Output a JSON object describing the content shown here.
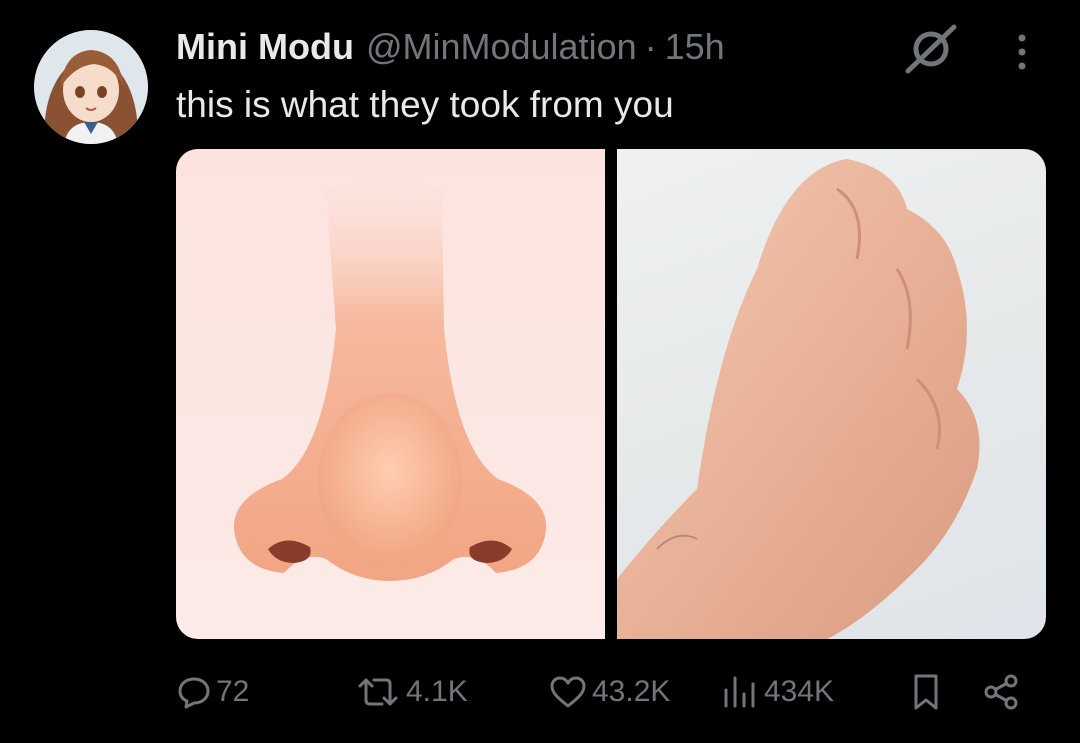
{
  "post": {
    "author": {
      "display_name": "Mini Modu",
      "handle": "@MinModulation",
      "separator": "·",
      "time": "15h"
    },
    "text": "this is what they took from you",
    "media": [
      {
        "icon": "nose-image"
      },
      {
        "icon": "fist-image"
      }
    ],
    "actions": {
      "replies": "72",
      "reposts": "4.1K",
      "likes": "43.2K",
      "views": "434K"
    }
  },
  "icons": {
    "reply": "speech-bubble-icon",
    "repost": "repost-arrows-icon",
    "like": "heart-icon",
    "views": "bar-chart-icon",
    "bookmark": "bookmark-icon",
    "share": "share-icon",
    "grok": "grok-icon",
    "more": "more-vertical-icon"
  },
  "colors": {
    "background": "#000000",
    "primary_text": "#e7e9ea",
    "secondary_text": "#71767b"
  }
}
